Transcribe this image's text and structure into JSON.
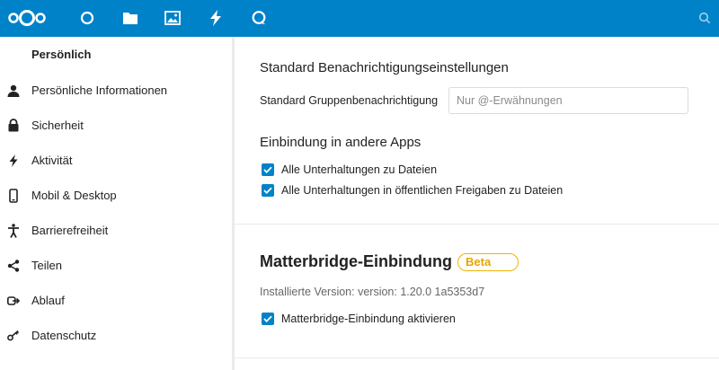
{
  "header": {
    "colors": {
      "background": "#0082c9",
      "icon": "#ffffff"
    },
    "apps": [
      {
        "name": "nextcloud-logo-icon"
      },
      {
        "name": "dashboard-icon"
      },
      {
        "name": "files-icon"
      },
      {
        "name": "photos-icon"
      },
      {
        "name": "activity-icon"
      },
      {
        "name": "talk-icon"
      }
    ],
    "search_icon": "search-icon"
  },
  "sidebar": {
    "heading": "Persönlich",
    "items": [
      {
        "label": "Persönliche Informationen",
        "icon": "user-icon"
      },
      {
        "label": "Sicherheit",
        "icon": "lock-icon"
      },
      {
        "label": "Aktivität",
        "icon": "activity-icon"
      },
      {
        "label": "Mobil & Desktop",
        "icon": "phone-icon"
      },
      {
        "label": "Barrierefreiheit",
        "icon": "accessibility-icon"
      },
      {
        "label": "Teilen",
        "icon": "share-icon"
      },
      {
        "label": "Ablauf",
        "icon": "flow-icon"
      },
      {
        "label": "Datenschutz",
        "icon": "key-icon"
      }
    ]
  },
  "notifications": {
    "title": "Standard Benachrichtigungseinstellungen",
    "group_label": "Standard Gruppenbenachrichtigung",
    "group_placeholder": "Nur @-Erwähnungen"
  },
  "integration": {
    "title": "Einbindung in andere Apps",
    "options": [
      {
        "label": "Alle Unterhaltungen zu Dateien",
        "checked": true
      },
      {
        "label": "Alle Unterhaltungen in öffentlichen Freigaben zu Dateien",
        "checked": true
      }
    ]
  },
  "matterbridge": {
    "title": "Matterbridge-Einbindung",
    "badge": "Beta",
    "version": "Installierte Version: version: 1.20.0 1a5353d7",
    "enable_label": "Matterbridge-Einbindung aktivieren",
    "enable_checked": true
  },
  "colors": {
    "accent": "#0082c9",
    "beta": "#f0b400"
  }
}
